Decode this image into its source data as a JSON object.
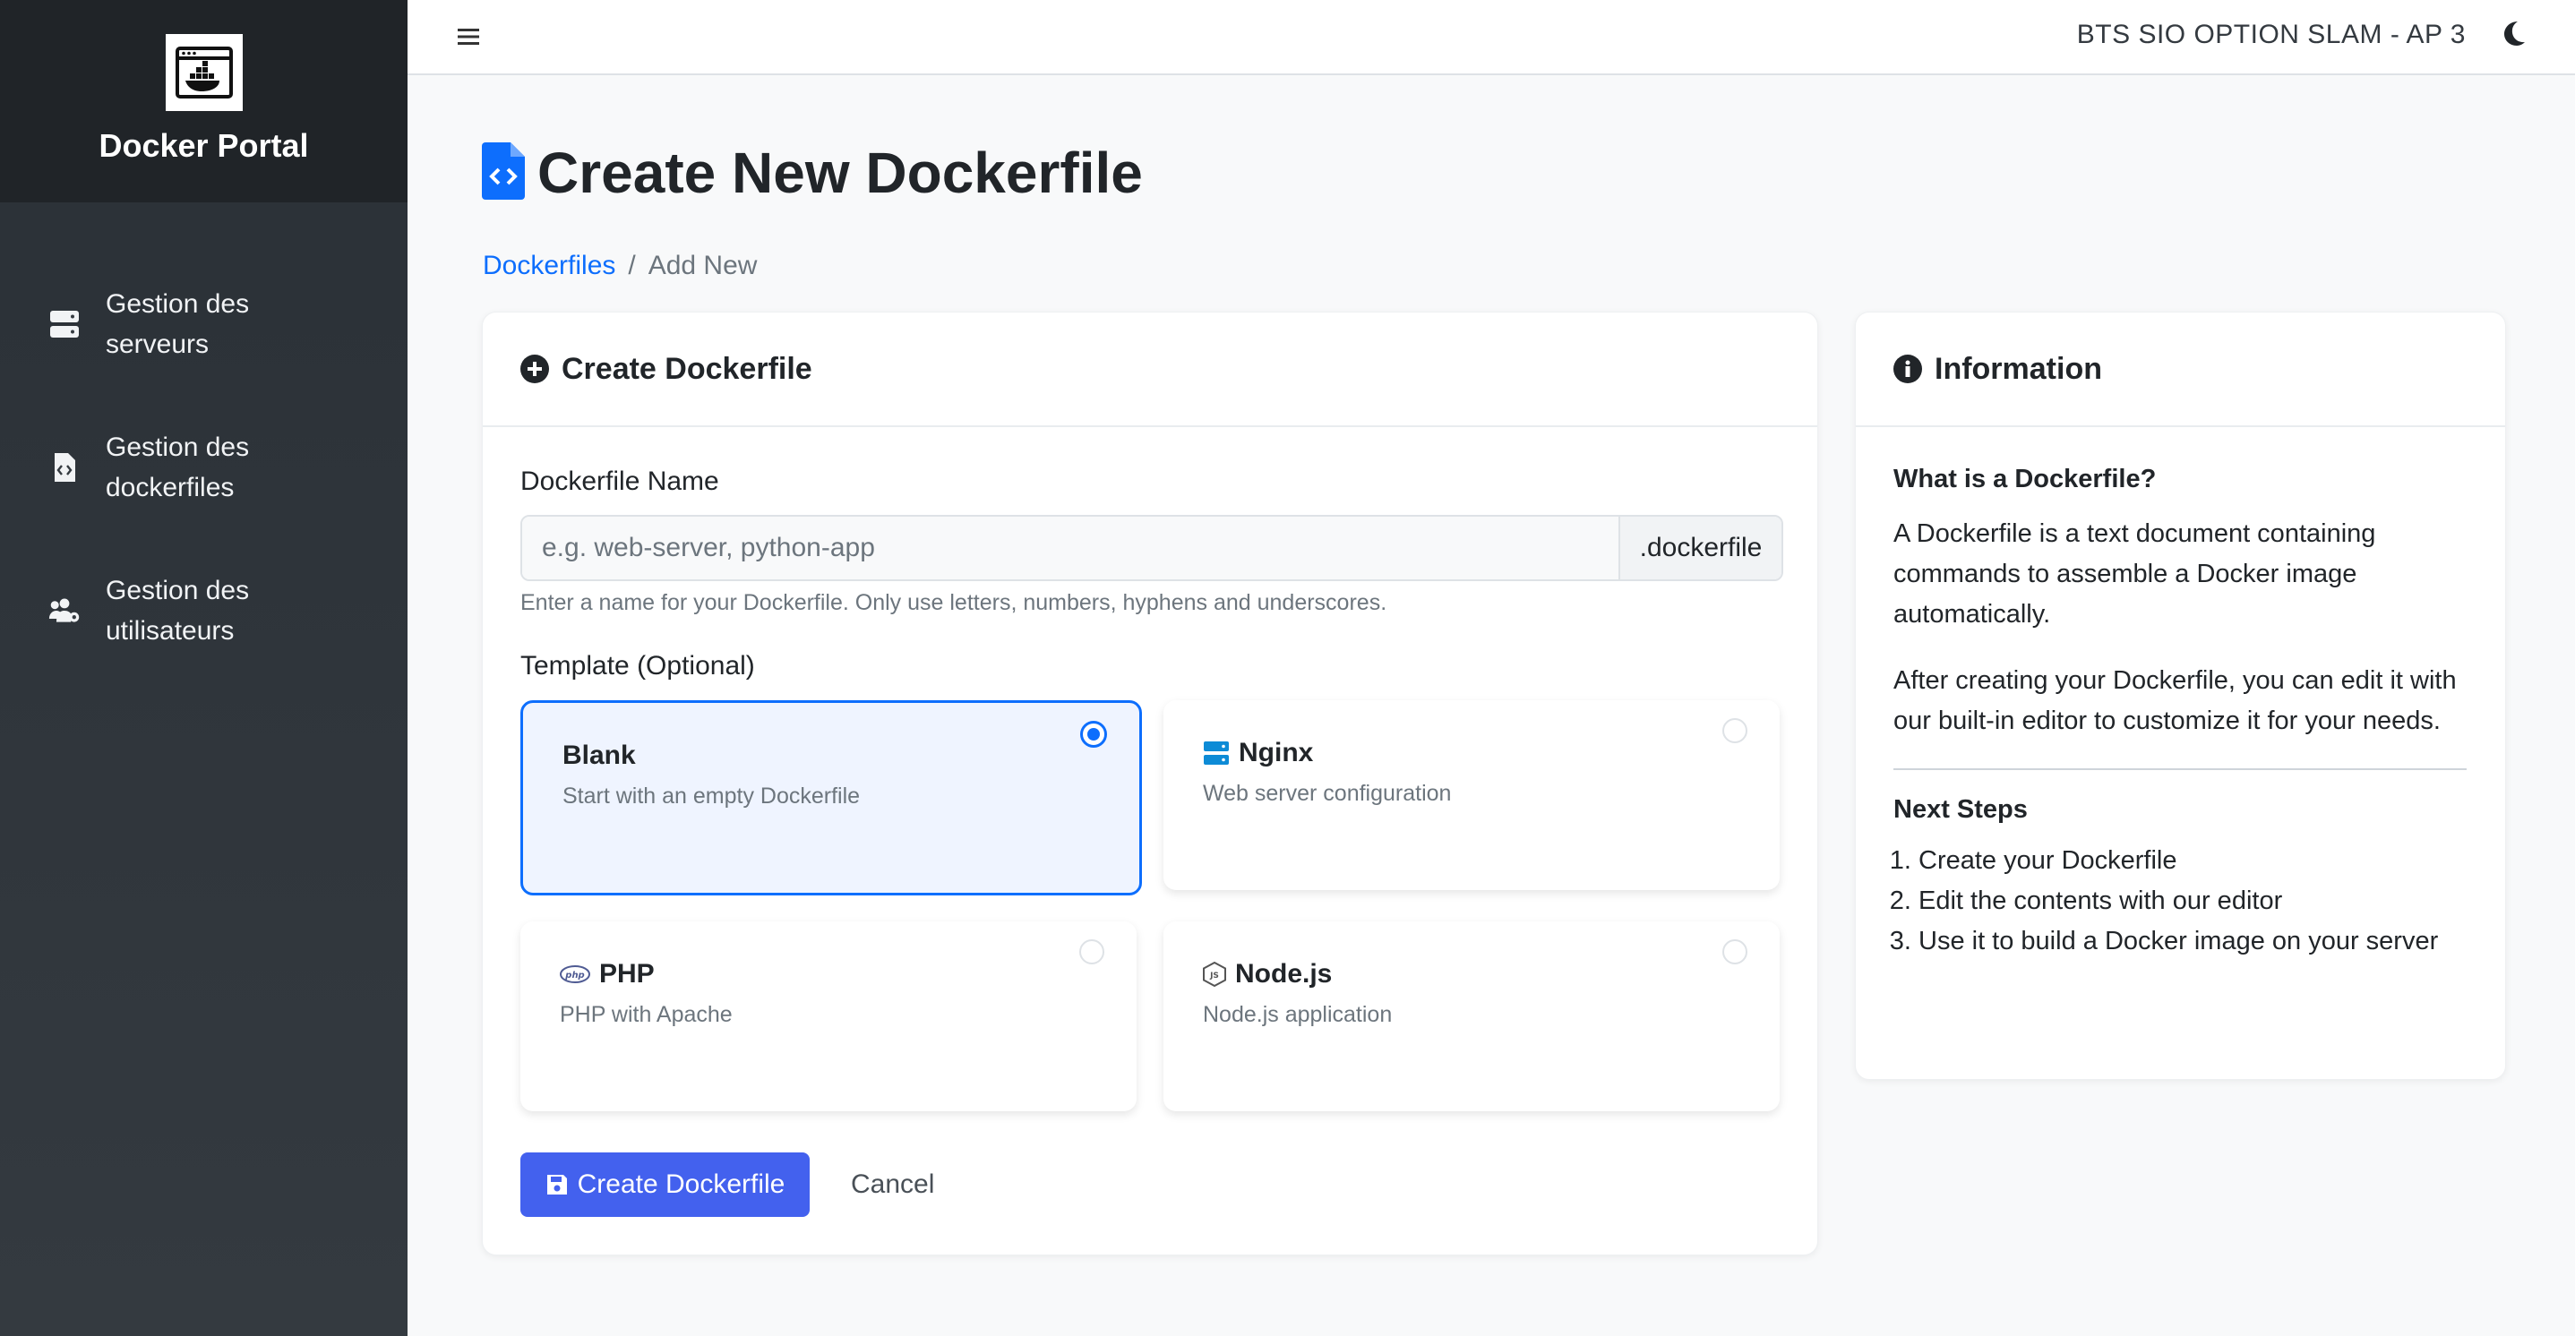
{
  "sidebar": {
    "brand_title": "Docker Portal",
    "brand_icon": "docker-window-icon",
    "items": [
      {
        "label": "Gestion des serveurs",
        "icon": "server-icon"
      },
      {
        "label": "Gestion des dockerfiles",
        "icon": "file-code-icon"
      },
      {
        "label": "Gestion des utilisateurs",
        "icon": "users-cog-icon"
      }
    ]
  },
  "topbar": {
    "menu_icon": "hamburger-icon",
    "title": "BTS SIO OPTION SLAM - AP 3",
    "theme_icon": "moon-icon"
  },
  "page": {
    "title": "Create New Dockerfile",
    "title_icon": "file-code-icon",
    "breadcrumb": {
      "link": "Dockerfiles",
      "separator": "/",
      "current": "Add New"
    }
  },
  "form_card": {
    "header": "Create Dockerfile",
    "header_icon": "plus-circle-icon",
    "name_label": "Dockerfile Name",
    "name_placeholder": "e.g. web-server, python-app",
    "name_value": "",
    "name_suffix": ".dockerfile",
    "name_help": "Enter a name for your Dockerfile. Only use letters, numbers, hyphens and underscores.",
    "template_label": "Template (Optional)",
    "templates": [
      {
        "name": "Blank",
        "description": "Start with an empty Dockerfile",
        "icon": "",
        "selected": true
      },
      {
        "name": "Nginx",
        "description": "Web server configuration",
        "icon": "server-icon",
        "selected": false
      },
      {
        "name": "PHP",
        "description": "PHP with Apache",
        "icon": "php-icon",
        "selected": false
      },
      {
        "name": "Node.js",
        "description": "Node.js application",
        "icon": "nodejs-icon",
        "selected": false
      }
    ],
    "submit_label": "Create Dockerfile",
    "submit_icon": "save-icon",
    "cancel_label": "Cancel"
  },
  "info_card": {
    "header": "Information",
    "header_icon": "info-circle-icon",
    "what_title": "What is a Dockerfile?",
    "what_p1": "A Dockerfile is a text document containing commands to assemble a Docker image automatically.",
    "what_p2": "After creating your Dockerfile, you can edit it with our built-in editor to customize it for your needs.",
    "next_title": "Next Steps",
    "steps": [
      "Create your Dockerfile",
      "Edit the contents with our editor",
      "Use it to build a Docker image on your server"
    ]
  },
  "colors": {
    "sidebar_bg": "#343a40",
    "accent": "#0d6efd",
    "button": "#4361ee",
    "page_bg": "#f8f9fa"
  }
}
